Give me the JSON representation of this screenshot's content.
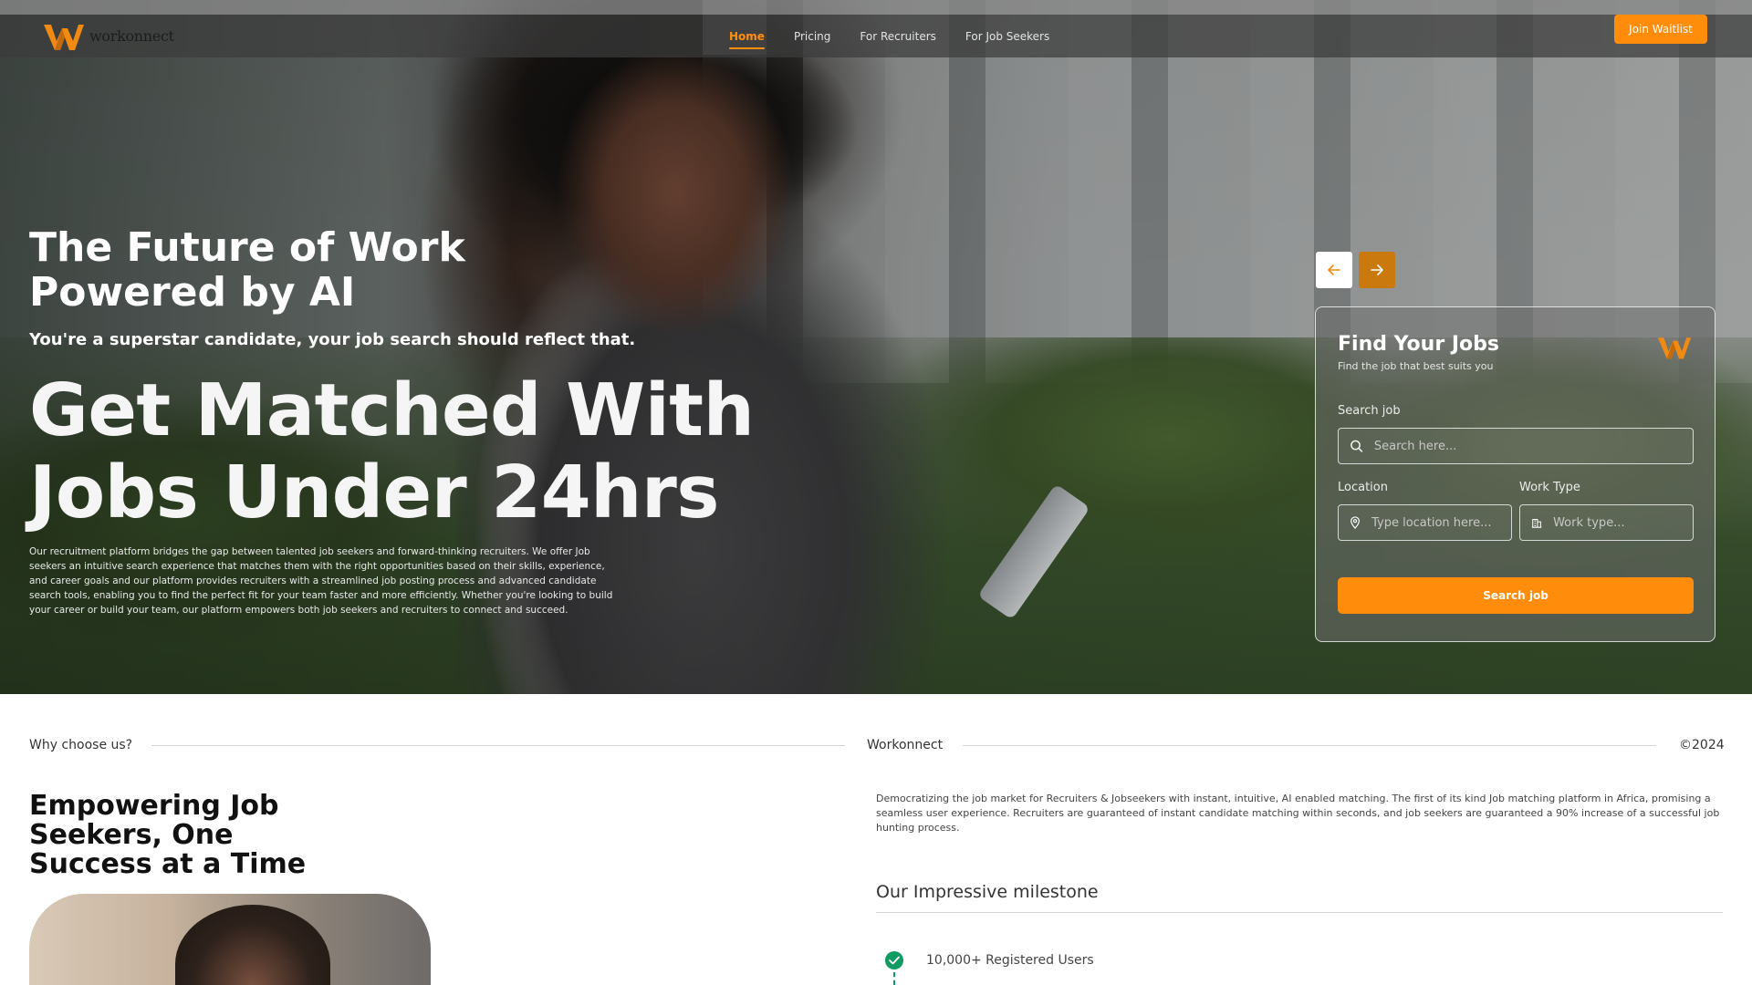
{
  "nav": {
    "brand": "workonnect",
    "links": [
      "Home",
      "Pricing",
      "For Recruiters",
      "For Job Seekers"
    ],
    "active_link": "Home",
    "cta_label": "Join Waitlist"
  },
  "hero": {
    "title": "The Future of Work Powered by AI",
    "subtitle": "You're a superstar candidate, your job search should reflect that.",
    "headline": "Get Matched With Jobs Under 24hrs",
    "description": "Our recruitment platform bridges the gap between talented job seekers and forward-thinking recruiters. We offer Job seekers an intuitive search experience that matches them with the right opportunities based on their skills, experience, and career goals and our platform provides recruiters with a streamlined job posting process and advanced candidate search tools, enabling you to find the perfect fit for your team faster and more efficiently. Whether you're looking to build your career or build your team, our platform empowers both job seekers and recruiters to connect and succeed."
  },
  "finder": {
    "title": "Find Your Jobs",
    "subtitle": "Find the job that best suits you",
    "search_label": "Search job",
    "search_placeholder": "Search here...",
    "location_label": "Location",
    "location_placeholder": "Type location here...",
    "worktype_label": "Work Type",
    "worktype_placeholder": "Work type...",
    "submit_label": "Search job"
  },
  "section": {
    "why_label": "Why choose us?",
    "brand_label": "Workonnect",
    "year": "©2024",
    "heading": "Empowering Job Seekers, One Success at a Time",
    "about": "Democratizing the job market for Recruiters & Jobseekers with instant, intuitive, AI enabled matching. The first of its kind Job matching platform in Africa, promising a seamless user experience. Recruiters are guaranteed of instant candidate matching within seconds, and job seekers are guaranteed a 90% increase of a successful job hunting process.",
    "milestone_title": "Our Impressive milestone",
    "milestones": [
      "10,000+ Registered Users"
    ]
  },
  "colors": {
    "accent": "#ff8c0a",
    "arrow_active": "#c9790e",
    "success": "#129a63"
  },
  "icons": [
    "logo-icon",
    "arrow-left-icon",
    "arrow-right-icon",
    "search-icon",
    "location-pin-icon",
    "building-icon",
    "check-icon"
  ]
}
